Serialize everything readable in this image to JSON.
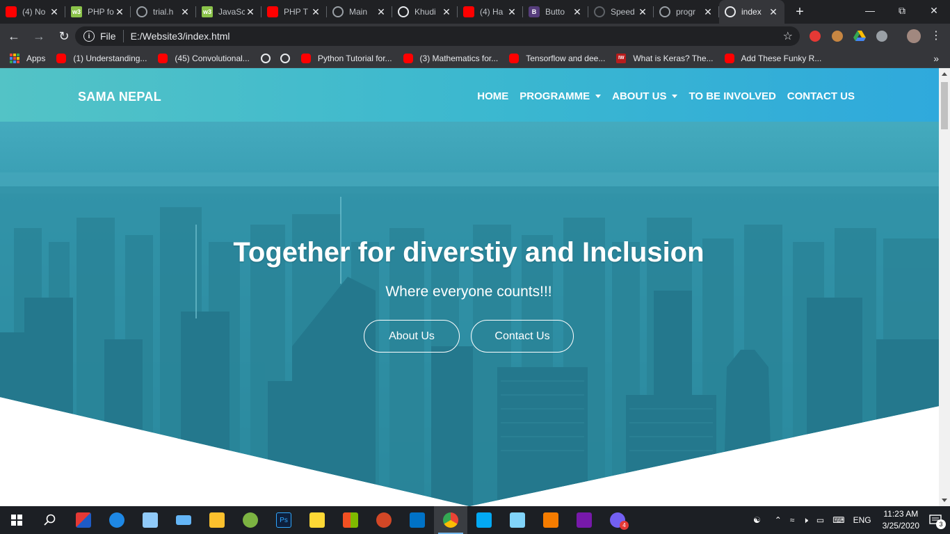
{
  "browser": {
    "tabs": [
      {
        "title": "(4) No",
        "favicon": "youtube-icon"
      },
      {
        "title": "PHP fo",
        "favicon": "w3schools-icon"
      },
      {
        "title": "trial.h",
        "favicon": "globe-icon"
      },
      {
        "title": "JavaSc",
        "favicon": "w3schools-icon"
      },
      {
        "title": "PHP T",
        "favicon": "youtube-icon"
      },
      {
        "title": "Main",
        "favicon": "globe-icon"
      },
      {
        "title": "Khudi",
        "favicon": "globe-icon"
      },
      {
        "title": "(4) Ha",
        "favicon": "youtube-icon"
      },
      {
        "title": "Butto",
        "favicon": "bootstrap-icon"
      },
      {
        "title": "Speed",
        "favicon": "speed-icon"
      },
      {
        "title": "progr",
        "favicon": "globe-icon"
      },
      {
        "title": "index",
        "favicon": "globe-icon",
        "active": true
      }
    ],
    "address": {
      "scheme_label": "File",
      "url": "E:/Website3/index.html"
    },
    "bookmarks": [
      {
        "label": "Apps",
        "icon": "apps-icon"
      },
      {
        "label": "(1) Understanding...",
        "icon": "youtube-icon"
      },
      {
        "label": "(45) Convolutional...",
        "icon": "youtube-icon"
      },
      {
        "label": "",
        "icon": "globe-icon"
      },
      {
        "label": "",
        "icon": "globe-icon"
      },
      {
        "label": "Python Tutorial for...",
        "icon": "youtube-icon"
      },
      {
        "label": "(3) Mathematics for...",
        "icon": "youtube-icon"
      },
      {
        "label": "Tensorflow and dee...",
        "icon": "youtube-icon"
      },
      {
        "label": "What is Keras? The...",
        "icon": "iw-icon"
      },
      {
        "label": "Add These Funky R...",
        "icon": "youtube-icon"
      }
    ],
    "bookmarks_more": "»"
  },
  "site": {
    "brand": "SAMA NEPAL",
    "nav": [
      {
        "label": "HOME",
        "dropdown": false
      },
      {
        "label": "PROGRAMME",
        "dropdown": true
      },
      {
        "label": "ABOUT US",
        "dropdown": true
      },
      {
        "label": "TO BE INVOLVED",
        "dropdown": false
      },
      {
        "label": "CONTACT US",
        "dropdown": false
      }
    ],
    "hero": {
      "title": "Together for diverstiy and Inclusion",
      "subtitle": "Where everyone counts!!!",
      "buttons": [
        "About Us",
        "Contact Us"
      ]
    },
    "colors": {
      "nav_gradient_start": "#53c3c6",
      "nav_gradient_end": "#2fa9dc",
      "hero_overlay": "#2a8aa3"
    }
  },
  "taskbar": {
    "apps": [
      "start-icon",
      "search-icon",
      "wps-presentation-icon",
      "edge-icon",
      "this-pc-icon",
      "laptop-icon",
      "file-explorer-icon",
      "utorrent-icon",
      "photoshop-icon",
      "onedrive-icon",
      "store-icon",
      "powerpoint-icon",
      "outlook-icon",
      "chrome-icon",
      "ccleaner-icon",
      "control-panel-icon",
      "sublime-text-icon",
      "onenote-icon",
      "viber-icon"
    ],
    "viber_badge": "4",
    "language": "ENG",
    "time": "11:23 AM",
    "date": "3/25/2020",
    "notification_count": "3"
  }
}
